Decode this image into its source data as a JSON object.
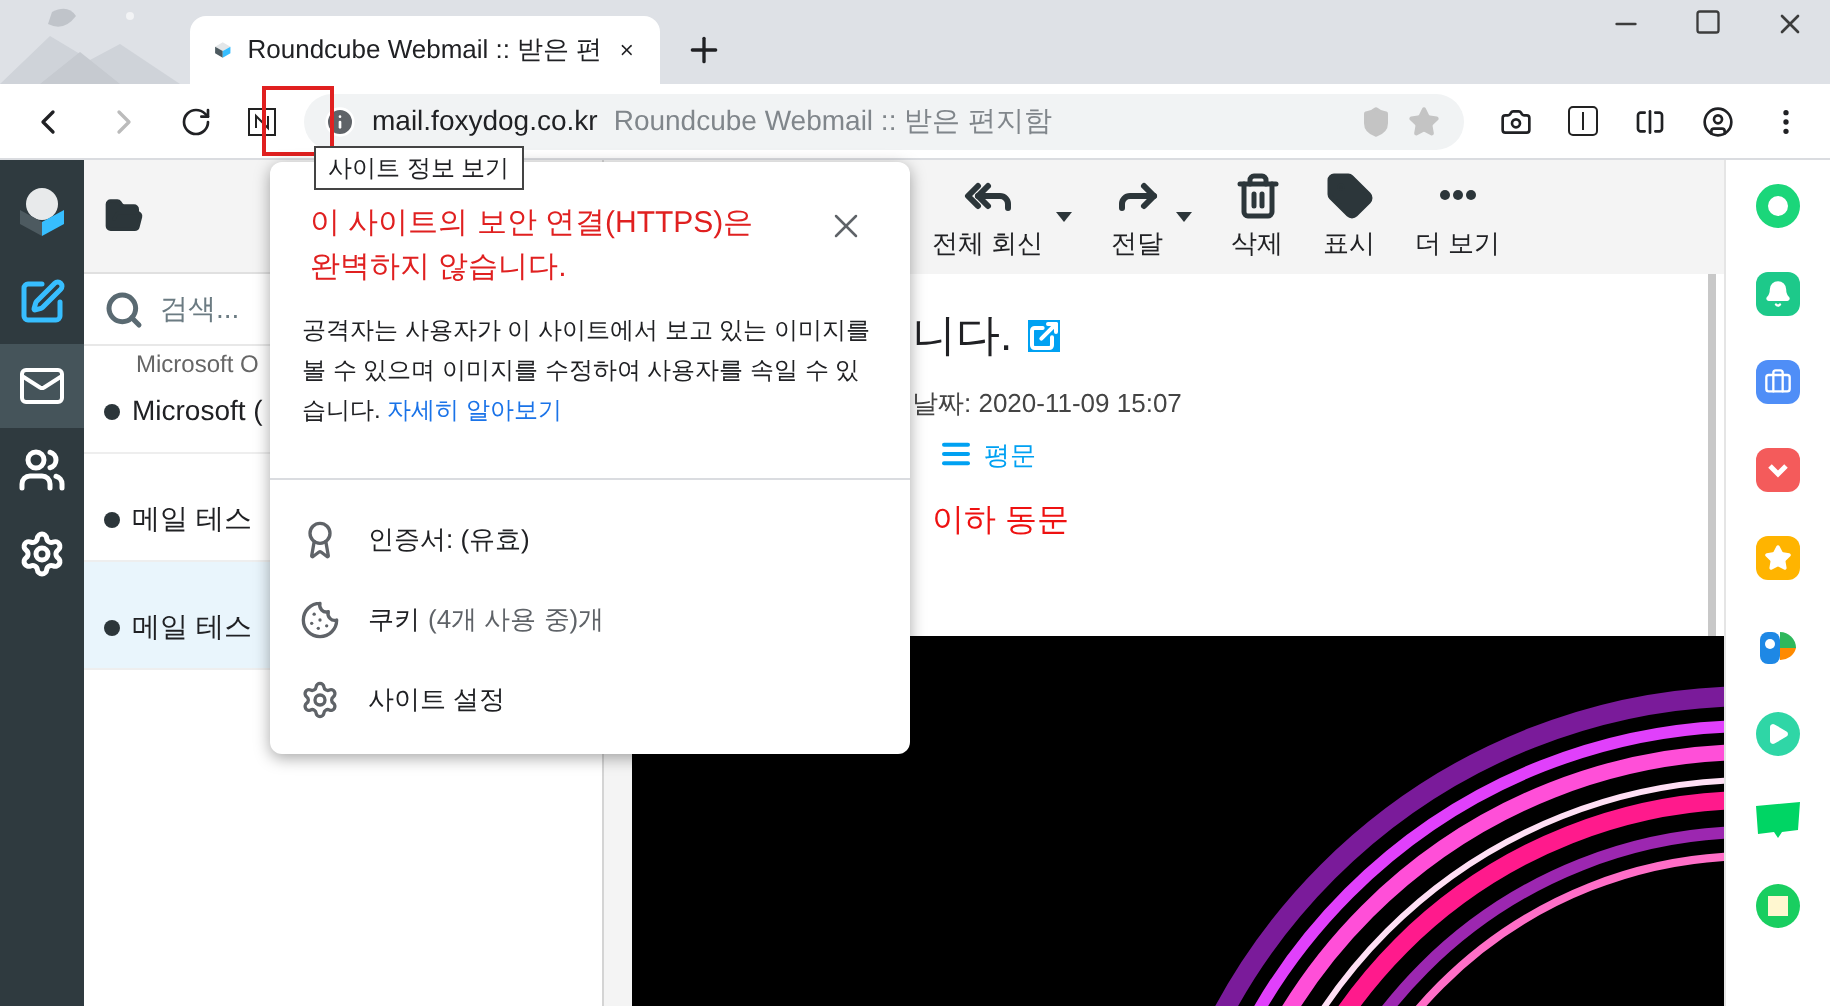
{
  "browser": {
    "tab": {
      "title": "Roundcube Webmail :: 받은 편"
    },
    "address": {
      "host": "mail.foxydog.co.kr",
      "page_title": "Roundcube Webmail :: 받은 편지함"
    },
    "tooltip": "사이트 정보 보기"
  },
  "site_info_popup": {
    "heading": "이 사이트의 보안 연결(HTTPS)은 완벽하지 않습니다.",
    "body": "공격자는 사용자가 이 사이트에서 보고 있는 이미지를 볼 수 있으며 이미지를 수정하여 사용자를 속일 수 있습니다.",
    "link": "자세히 알아보기",
    "items": [
      {
        "kind": "certificate",
        "label": "인증서: (유효)"
      },
      {
        "kind": "cookie",
        "label": "쿠키",
        "detail": "(4개 사용 중)개"
      },
      {
        "kind": "settings",
        "label": "사이트 설정"
      }
    ]
  },
  "sidebar": {
    "items": [
      {
        "kind": "compose",
        "selected": false
      },
      {
        "kind": "mail",
        "selected": true
      },
      {
        "kind": "contacts",
        "selected": false
      },
      {
        "kind": "settings",
        "selected": false
      }
    ]
  },
  "search": {
    "placeholder": "검색..."
  },
  "messages": [
    {
      "from": "Microsoft O",
      "subject": "Microsoft (",
      "selected": false
    },
    {
      "subject": "메일 테스",
      "selected": false
    },
    {
      "subject": "메일 테스",
      "selected": true
    }
  ],
  "toolbar": [
    {
      "kind": "reply-all",
      "label": "전체 회신",
      "dropdown": true
    },
    {
      "kind": "forward",
      "label": "전달",
      "dropdown": true
    },
    {
      "kind": "delete",
      "label": "삭제",
      "dropdown": false
    },
    {
      "kind": "mark",
      "label": "표시",
      "dropdown": false
    },
    {
      "kind": "more",
      "label": "더 보기",
      "dropdown": false
    }
  ],
  "message": {
    "title": "니다.",
    "date": "날짜: 2020-11-09 15:07",
    "view": "평문",
    "body": "이하 동문"
  }
}
